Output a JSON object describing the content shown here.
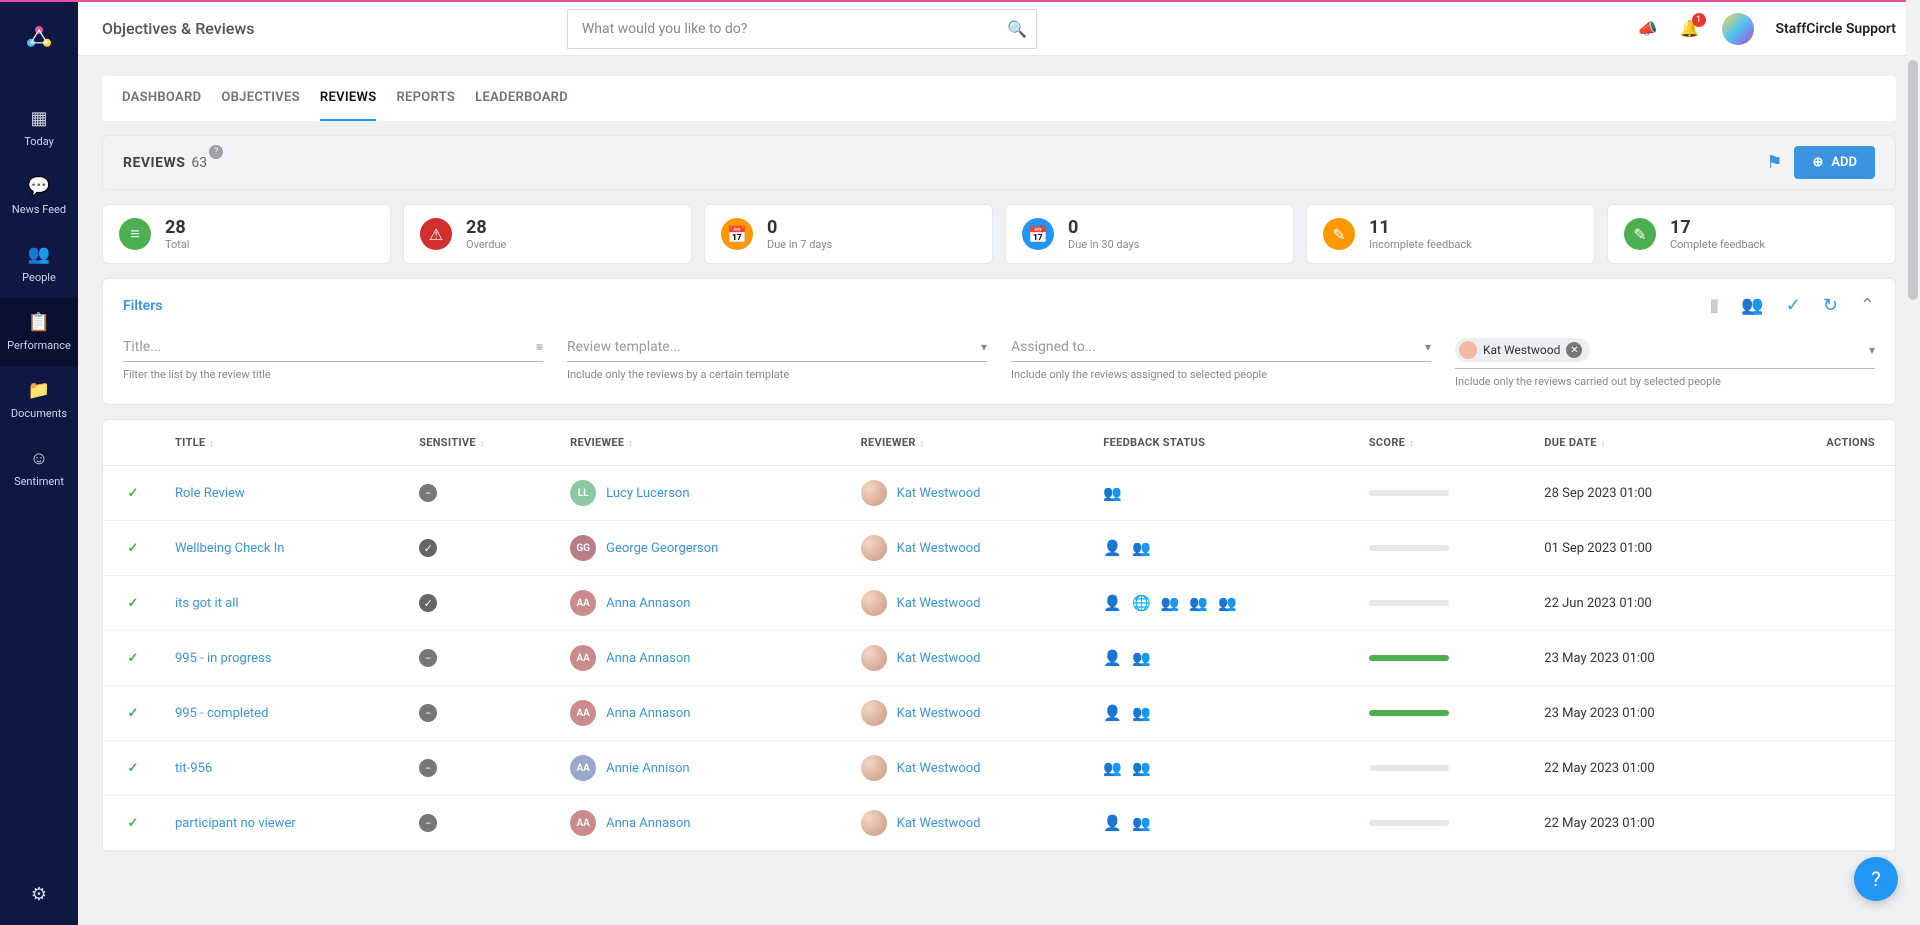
{
  "header": {
    "page_title": "Objectives & Reviews",
    "search_placeholder": "What would you like to do?",
    "notification_badge": "1",
    "user_name": "StaffCircle Support"
  },
  "sidebar": {
    "items": [
      {
        "label": "Today",
        "icon": "grid"
      },
      {
        "label": "News Feed",
        "icon": "chat"
      },
      {
        "label": "People",
        "icon": "people"
      },
      {
        "label": "Performance",
        "icon": "clipboard"
      },
      {
        "label": "Documents",
        "icon": "folder"
      },
      {
        "label": "Sentiment",
        "icon": "smile"
      }
    ]
  },
  "tabs": [
    {
      "label": "DASHBOARD"
    },
    {
      "label": "OBJECTIVES"
    },
    {
      "label": "REVIEWS"
    },
    {
      "label": "REPORTS"
    },
    {
      "label": "LEADERBOARD"
    }
  ],
  "reviews_header": {
    "title": "REVIEWS",
    "count": "63",
    "add_label": "ADD"
  },
  "stats": [
    {
      "num": "28",
      "label": "Total",
      "color": "green",
      "icon": "≡"
    },
    {
      "num": "28",
      "label": "Overdue",
      "color": "red",
      "icon": "⚠"
    },
    {
      "num": "0",
      "label": "Due in 7 days",
      "color": "orange",
      "icon": "📅"
    },
    {
      "num": "0",
      "label": "Due in 30 days",
      "color": "blue",
      "icon": "📅"
    },
    {
      "num": "11",
      "label": "Incomplete feedback",
      "color": "orange",
      "icon": "✎"
    },
    {
      "num": "17",
      "label": "Complete feedback",
      "color": "green",
      "icon": "✎"
    }
  ],
  "filters": {
    "title": "Filters",
    "title_ph": "Title...",
    "title_help": "Filter the list by the review title",
    "tpl_ph": "Review template...",
    "tpl_help": "Include only the reviews by a certain template",
    "assigned_ph": "Assigned to...",
    "assigned_help": "Include only the reviews assigned to selected people",
    "reviewer_chip": "Kat Westwood",
    "reviewer_help": "Include only the reviews carried out by selected people"
  },
  "table": {
    "headers": {
      "title": "TITLE",
      "sensitive": "SENSITIVE",
      "reviewee": "REVIEWEE",
      "reviewer": "REVIEWER",
      "feedback": "FEEDBACK STATUS",
      "score": "SCORE",
      "due": "DUE DATE",
      "actions": "ACTIONS"
    },
    "rows": [
      {
        "title": "Role Review",
        "sensitive": "minus",
        "reviewee": {
          "name": "Lucy Lucerson",
          "initials": "LL",
          "color": "#8bc9a3"
        },
        "reviewer": "Kat Westwood",
        "feedback": [
          {
            "i": "👥",
            "c": "g"
          }
        ],
        "score": 0,
        "due": "28 Sep 2023 01:00"
      },
      {
        "title": "Wellbeing Check In",
        "sensitive": "check",
        "reviewee": {
          "name": "George Georgerson",
          "initials": "GG",
          "color": "#b87d87"
        },
        "reviewer": "Kat Westwood",
        "feedback": [
          {
            "i": "👤",
            "c": "g"
          },
          {
            "i": "👥",
            "c": "g"
          }
        ],
        "score": 0,
        "due": "01 Sep 2023 01:00"
      },
      {
        "title": "its got it all",
        "sensitive": "check",
        "reviewee": {
          "name": "Anna Annason",
          "initials": "AA",
          "color": "#c98b8b"
        },
        "reviewer": "Kat Westwood",
        "feedback": [
          {
            "i": "👤",
            "c": "r"
          },
          {
            "i": "🌐",
            "c": "r"
          },
          {
            "i": "👥",
            "c": "r"
          },
          {
            "i": "👥",
            "c": "r"
          },
          {
            "i": "👥",
            "c": "r"
          }
        ],
        "score": 0,
        "due": "22 Jun 2023 01:00"
      },
      {
        "title": "995 - in progress",
        "sensitive": "minus",
        "reviewee": {
          "name": "Anna Annason",
          "initials": "AA",
          "color": "#c98b8b"
        },
        "reviewer": "Kat Westwood",
        "feedback": [
          {
            "i": "👤",
            "c": "g"
          },
          {
            "i": "👥",
            "c": "g"
          }
        ],
        "score": 100,
        "due": "23 May 2023 01:00"
      },
      {
        "title": "995 - completed",
        "sensitive": "minus",
        "reviewee": {
          "name": "Anna Annason",
          "initials": "AA",
          "color": "#c98b8b"
        },
        "reviewer": "Kat Westwood",
        "feedback": [
          {
            "i": "👤",
            "c": "g"
          },
          {
            "i": "👥",
            "c": "g"
          }
        ],
        "score": 100,
        "due": "23 May 2023 01:00"
      },
      {
        "title": "tit-956",
        "sensitive": "minus",
        "reviewee": {
          "name": "Annie Annison",
          "initials": "AA",
          "color": "#9aa8c9"
        },
        "reviewer": "Kat Westwood",
        "feedback": [
          {
            "i": "👥",
            "c": "r"
          },
          {
            "i": "👥",
            "c": "r"
          }
        ],
        "score": 0,
        "due": "22 May 2023 01:00"
      },
      {
        "title": "participant no viewer",
        "sensitive": "minus",
        "reviewee": {
          "name": "Anna Annason",
          "initials": "AA",
          "color": "#c98b8b"
        },
        "reviewer": "Kat Westwood",
        "feedback": [
          {
            "i": "👤",
            "c": "g"
          },
          {
            "i": "👥",
            "c": "g"
          }
        ],
        "score": 0,
        "due": "22 May 2023 01:00"
      }
    ]
  }
}
